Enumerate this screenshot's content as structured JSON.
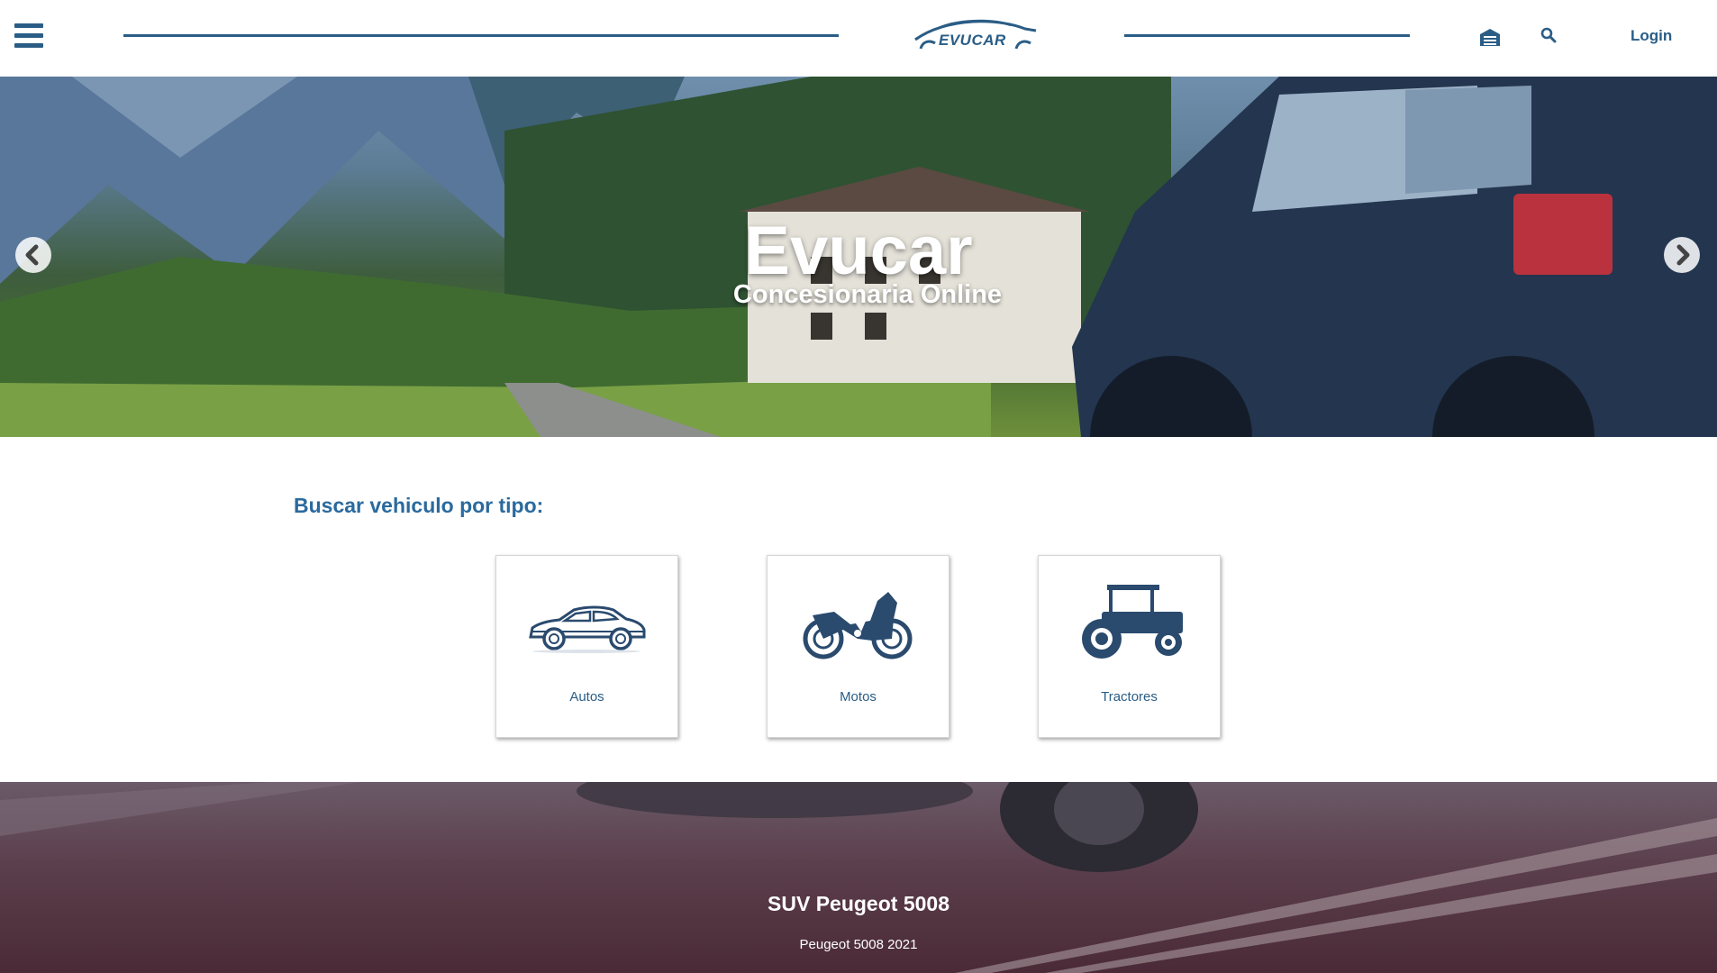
{
  "header": {
    "brand": "EVUCAR",
    "login_label": "Login",
    "icons": [
      "menu-icon",
      "garage-icon",
      "search-icon"
    ]
  },
  "hero": {
    "title": "Evucar",
    "subtitle": "Concesionaria Online"
  },
  "vehicle_types": {
    "heading": "Buscar vehiculo por tipo:",
    "items": [
      {
        "label": "Autos",
        "icon": "car-icon"
      },
      {
        "label": "Motos",
        "icon": "motorcycle-icon"
      },
      {
        "label": "Tractores",
        "icon": "tractor-icon"
      }
    ]
  },
  "promo": {
    "title": "SUV Peugeot 5008",
    "subtitle": "Peugeot 5008 2021"
  },
  "colors": {
    "brand_blue": "#2a5d86",
    "heading_blue": "#2a6a9e"
  }
}
